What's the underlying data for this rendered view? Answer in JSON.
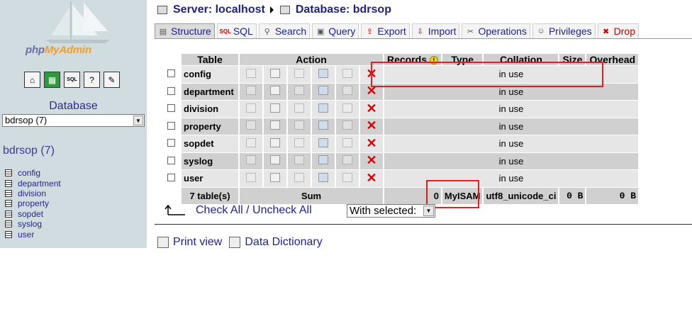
{
  "left": {
    "logo": {
      "php": "php",
      "myadmin": "MyAdmin"
    },
    "quick_icons": [
      "home-icon",
      "query-window-icon",
      "sql-icon",
      "docs-icon",
      "help-icon"
    ],
    "database_label": "Database",
    "database_select": "bdrsop (7)",
    "db_heading": "bdrsop (7)",
    "tables": [
      "config",
      "department",
      "division",
      "property",
      "sopdet",
      "syslog",
      "user"
    ]
  },
  "header": {
    "server_label": "Server: localhost",
    "database_label": "Database: bdrsop"
  },
  "tabs": [
    {
      "label": "Structure",
      "icon": "structure-icon",
      "active": true
    },
    {
      "label": "SQL",
      "icon": "sql-icon"
    },
    {
      "label": "Search",
      "icon": "search-icon"
    },
    {
      "label": "Query",
      "icon": "query-icon"
    },
    {
      "label": "Export",
      "icon": "export-icon"
    },
    {
      "label": "Import",
      "icon": "import-icon"
    },
    {
      "label": "Operations",
      "icon": "operations-icon"
    },
    {
      "label": "Privileges",
      "icon": "privileges-icon"
    },
    {
      "label": "Drop",
      "icon": "drop-icon"
    }
  ],
  "table": {
    "headers": {
      "table": "Table",
      "action": "Action",
      "records": "Records",
      "type": "Type",
      "collation": "Collation",
      "size": "Size",
      "overhead": "Overhead"
    },
    "rows": [
      {
        "name": "config",
        "status": "in use"
      },
      {
        "name": "department",
        "status": "in use"
      },
      {
        "name": "division",
        "status": "in use"
      },
      {
        "name": "property",
        "status": "in use"
      },
      {
        "name": "sopdet",
        "status": "in use"
      },
      {
        "name": "syslog",
        "status": "in use"
      },
      {
        "name": "user",
        "status": "in use"
      }
    ],
    "summary": {
      "count": "7 table(s)",
      "sum": "Sum",
      "records": "0",
      "type": "MyISAM",
      "collation": "utf8_unicode_ci",
      "size": "0 B",
      "overhead": "0 B"
    }
  },
  "check_all": "Check All / Uncheck All",
  "with_selected": "With selected:",
  "footer": {
    "print": "Print view",
    "dict": "Data Dictionary"
  },
  "colors": {
    "sidebar": "#d0dce0",
    "link": "#22228c",
    "highlight": "#e02020"
  }
}
